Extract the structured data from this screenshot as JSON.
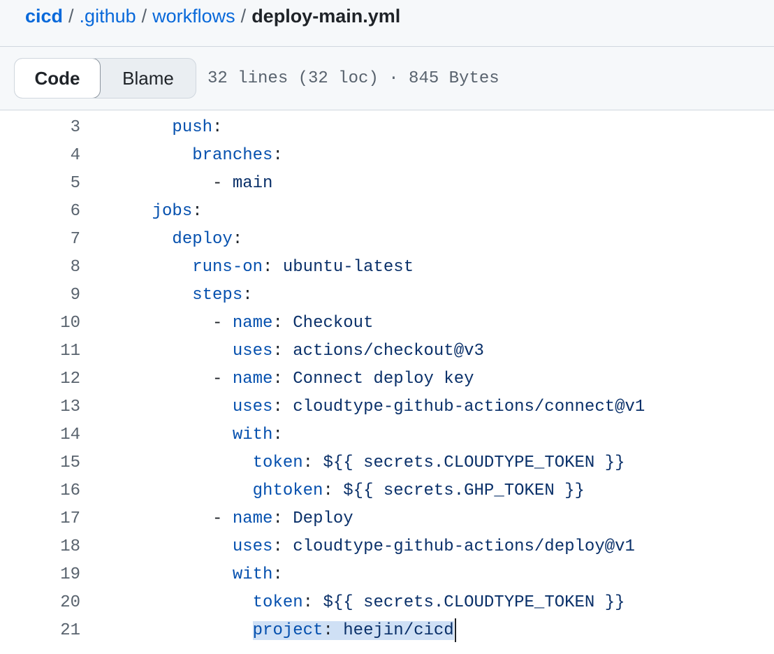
{
  "breadcrumb": {
    "repo": "cicd",
    "folder1": ".github",
    "folder2": "workflows",
    "file": "deploy-main.yml",
    "separator": "/"
  },
  "toolbar": {
    "code_label": "Code",
    "blame_label": "Blame",
    "file_meta": "32 lines (32 loc) · 845 Bytes"
  },
  "code_lines": [
    {
      "num": "3",
      "indent": "  ",
      "key": "push",
      "sep": ":",
      "value": ""
    },
    {
      "num": "4",
      "indent": "    ",
      "key": "branches",
      "sep": ":",
      "value": ""
    },
    {
      "num": "5",
      "indent": "      ",
      "dash": "- ",
      "key": "",
      "sep": "",
      "value": "main"
    },
    {
      "num": "6",
      "indent": "",
      "key": "jobs",
      "sep": ":",
      "value": ""
    },
    {
      "num": "7",
      "indent": "  ",
      "key": "deploy",
      "sep": ":",
      "value": ""
    },
    {
      "num": "8",
      "indent": "    ",
      "key": "runs-on",
      "sep": ": ",
      "value": "ubuntu-latest"
    },
    {
      "num": "9",
      "indent": "    ",
      "key": "steps",
      "sep": ":",
      "value": ""
    },
    {
      "num": "10",
      "indent": "      ",
      "dash": "- ",
      "key": "name",
      "sep": ": ",
      "value": "Checkout"
    },
    {
      "num": "11",
      "indent": "        ",
      "key": "uses",
      "sep": ": ",
      "value": "actions/checkout@v3"
    },
    {
      "num": "12",
      "indent": "      ",
      "dash": "- ",
      "key": "name",
      "sep": ": ",
      "value": "Connect deploy key"
    },
    {
      "num": "13",
      "indent": "        ",
      "key": "uses",
      "sep": ": ",
      "value": "cloudtype-github-actions/connect@v1"
    },
    {
      "num": "14",
      "indent": "        ",
      "key": "with",
      "sep": ":",
      "value": ""
    },
    {
      "num": "15",
      "indent": "          ",
      "key": "token",
      "sep": ": ",
      "value": "${{ secrets.CLOUDTYPE_TOKEN }}"
    },
    {
      "num": "16",
      "indent": "          ",
      "key": "ghtoken",
      "sep": ": ",
      "value": "${{ secrets.GHP_TOKEN }}"
    },
    {
      "num": "17",
      "indent": "      ",
      "dash": "- ",
      "key": "name",
      "sep": ": ",
      "value": "Deploy"
    },
    {
      "num": "18",
      "indent": "        ",
      "key": "uses",
      "sep": ": ",
      "value": "cloudtype-github-actions/deploy@v1"
    },
    {
      "num": "19",
      "indent": "        ",
      "key": "with",
      "sep": ":",
      "value": ""
    },
    {
      "num": "20",
      "indent": "          ",
      "key": "token",
      "sep": ": ",
      "value": "${{ secrets.CLOUDTYPE_TOKEN }}"
    },
    {
      "num": "21",
      "indent": "          ",
      "key": "project",
      "sep": ": ",
      "value": "heejin/cicd",
      "highlighted": true,
      "cursor": true
    }
  ],
  "colors": {
    "link": "#0969da",
    "yaml_key": "#0550ae",
    "yaml_value": "#0a3069",
    "line_number": "#59636e",
    "selection": "#cfe0f5"
  }
}
